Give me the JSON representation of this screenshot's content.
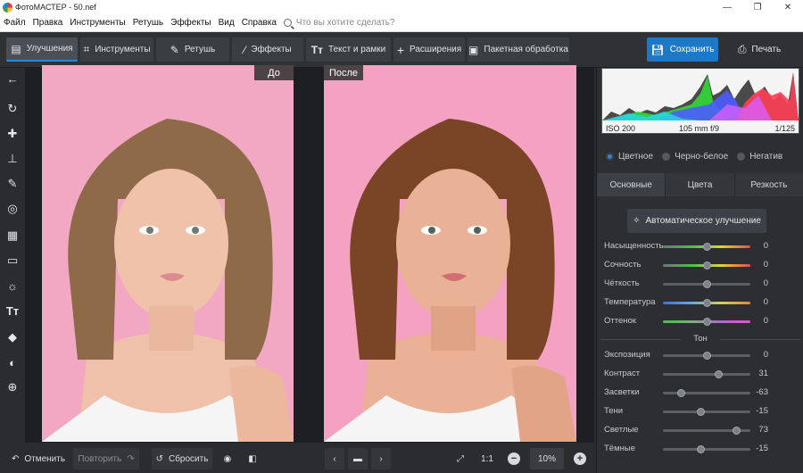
{
  "window": {
    "title": "ФотоМАСТЕР - 50.nef",
    "minimize": "—",
    "maximize": "❐",
    "close": "✕"
  },
  "menu": {
    "items": [
      "Файл",
      "Правка",
      "Инструменты",
      "Ретушь",
      "Эффекты",
      "Вид",
      "Справка"
    ],
    "search_placeholder": "Что вы хотите сделать?"
  },
  "toolbar": {
    "tabs": [
      {
        "label": "Улучшения",
        "icon": "enhance-icon",
        "active": true
      },
      {
        "label": "Инструменты",
        "icon": "crop-icon",
        "active": false
      },
      {
        "label": "Ретушь",
        "icon": "brush-icon",
        "active": false
      },
      {
        "label": "Эффекты",
        "icon": "magic-wand-icon",
        "active": false
      },
      {
        "label": "Текст и рамки",
        "icon": "text-icon",
        "active": false
      },
      {
        "label": "Расширения",
        "icon": "plus-icon",
        "active": false
      },
      {
        "label": "Пакетная обработка",
        "icon": "image-stack-icon",
        "active": false
      }
    ],
    "save_label": "Сохранить",
    "print_label": "Печать"
  },
  "compare": {
    "before_label": "До",
    "after_label": "После"
  },
  "histogram": {
    "iso": "ISO 200",
    "lens": "105 mm f/9",
    "shutter": "1/125"
  },
  "color_modes": [
    {
      "label": "Цветное",
      "selected": true
    },
    {
      "label": "Черно-белое",
      "selected": false
    },
    {
      "label": "Негатив",
      "selected": false
    }
  ],
  "panel_tabs": [
    {
      "label": "Основные",
      "active": true
    },
    {
      "label": "Цвета",
      "active": false
    },
    {
      "label": "Резкость",
      "active": false
    }
  ],
  "auto_enhance_label": "Автоматическое улучшение",
  "color_sliders": [
    {
      "label": "Насыщенность",
      "value": 0,
      "position": 0.5
    },
    {
      "label": "Сочность",
      "value": 0,
      "position": 0.5
    },
    {
      "label": "Чёткость",
      "value": 0,
      "position": 0.5
    },
    {
      "label": "Температура",
      "value": 0,
      "position": 0.5
    },
    {
      "label": "Оттенок",
      "value": 0,
      "position": 0.5
    }
  ],
  "tone_section_label": "Тон",
  "tone_sliders": [
    {
      "label": "Экспозиция",
      "value": 0,
      "position": 0.5
    },
    {
      "label": "Контраст",
      "value": 31,
      "position": 0.63
    },
    {
      "label": "Засветки",
      "value": -63,
      "position": 0.2
    },
    {
      "label": "Тени",
      "value": -15,
      "position": 0.43
    },
    {
      "label": "Светлые",
      "value": 73,
      "position": 0.84
    },
    {
      "label": "Тёмные",
      "value": -15,
      "position": 0.43
    }
  ],
  "bottom": {
    "undo_label": "Отменить",
    "redo_label": "Повторить",
    "reset_label": "Сбросить",
    "zoom_ratio": "1:1",
    "zoom_percent": "10%"
  },
  "colors": {
    "accent": "#2b88d8",
    "save_button": "#1e78c8",
    "backdrop_pink": "#f4a9c4"
  }
}
